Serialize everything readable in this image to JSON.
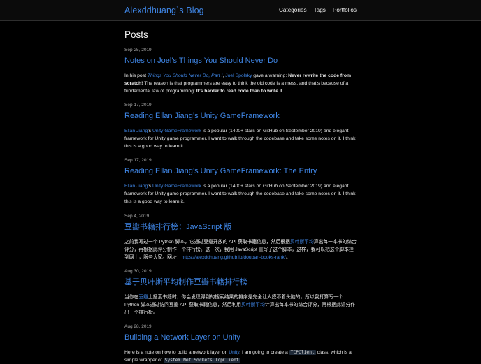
{
  "header": {
    "site_title": "Alexddhuang`s Blog",
    "nav": [
      "Categories",
      "Tags",
      "Portfolios"
    ]
  },
  "page": {
    "heading": "Posts"
  },
  "posts": [
    {
      "date": "Sep 25, 2019",
      "title": "Notes on Joel’s Things You Should Never Do",
      "excerpt": {
        "a": "In his post ",
        "link1": "Things You Should Never Do, Part I",
        "b": ", ",
        "link2": "Joel Spolsky",
        "c": " gave a warning: ",
        "bold1": "Never rewrite the code from scratch!",
        "d": " The reason is that programmers are easy to think the old code is a mess, and that’s because of a fundamental law of programming: ",
        "bold2": "It’s harder to read code than to write it",
        "e": "."
      }
    },
    {
      "date": "Sep 17, 2019",
      "title": "Reading Ellan Jiang’s Unity GameFramework",
      "excerpt": {
        "link1": "Ellan Jiang",
        "a": "’s ",
        "link2": "Unity GameFramework",
        "b": " is a popular (1400+ stars on GitHub on September 2019) and elegant framework for Unity game programmer. I want to walk through the codebase and take some notes on it. I think this is a good way to learn it."
      }
    },
    {
      "date": "Sep 17, 2019",
      "title": "Reading Ellan Jiang’s Unity GameFramework: The Entry",
      "excerpt": {
        "link1": "Ellan Jiang",
        "a": "’s ",
        "link2": "Unity GameFramework",
        "b": " is a popular (1400+ stars on GitHub on September 2019) and elegant framework for Unity game programmer. I want to walk through the codebase and take some notes on it. I think this is a good way to learn it."
      }
    },
    {
      "date": "Sep 4, 2019",
      "title": "豆瓣书籍排行榜：JavaScript 版",
      "excerpt": {
        "a": "之前我写过一个 Python 脚本，它通过豆瓣开放的 API 获取书籍信息，然后根据",
        "link1": "贝叶斯平均",
        "b": "算出每一本书的综合评分，再根据此评分制作一个排行榜。这一次，我用 JavaScript 重写了这个脚本，这样，我可以把这个脚本挂到网上，服务大家。网址：",
        "link2": "https://alexddhuang.github.io/douban-books-rank/",
        "c": "。"
      }
    },
    {
      "date": "Aug 30, 2019",
      "title": "基于贝叶斯平均制作豆瓣书籍排行榜",
      "excerpt": {
        "a": "当你在",
        "link1": "豆瓣",
        "b": "上搜索书籍时，你会发现得到的搜索结果的排序是完全让人摸不着头脑的，所以我打算写一个 Python 脚本通过访问豆瓣 API 获取书籍信息，然后利用",
        "link2": "贝叶斯平均",
        "c": "计算出每本书的综合评分，再根据此评分作出一个排行榜。"
      }
    },
    {
      "date": "Aug 28, 2019",
      "title": "Building a Network Layer on Unity",
      "excerpt": {
        "a": "Here is a note on how to build a network layer on ",
        "link1": "Unity",
        "b": ". I am going to create a ",
        "code1": "TCPClient",
        "c": " class, which is a simple wrapper of ",
        "code2": "System.Net.Sockets.TcpClient"
      }
    }
  ]
}
